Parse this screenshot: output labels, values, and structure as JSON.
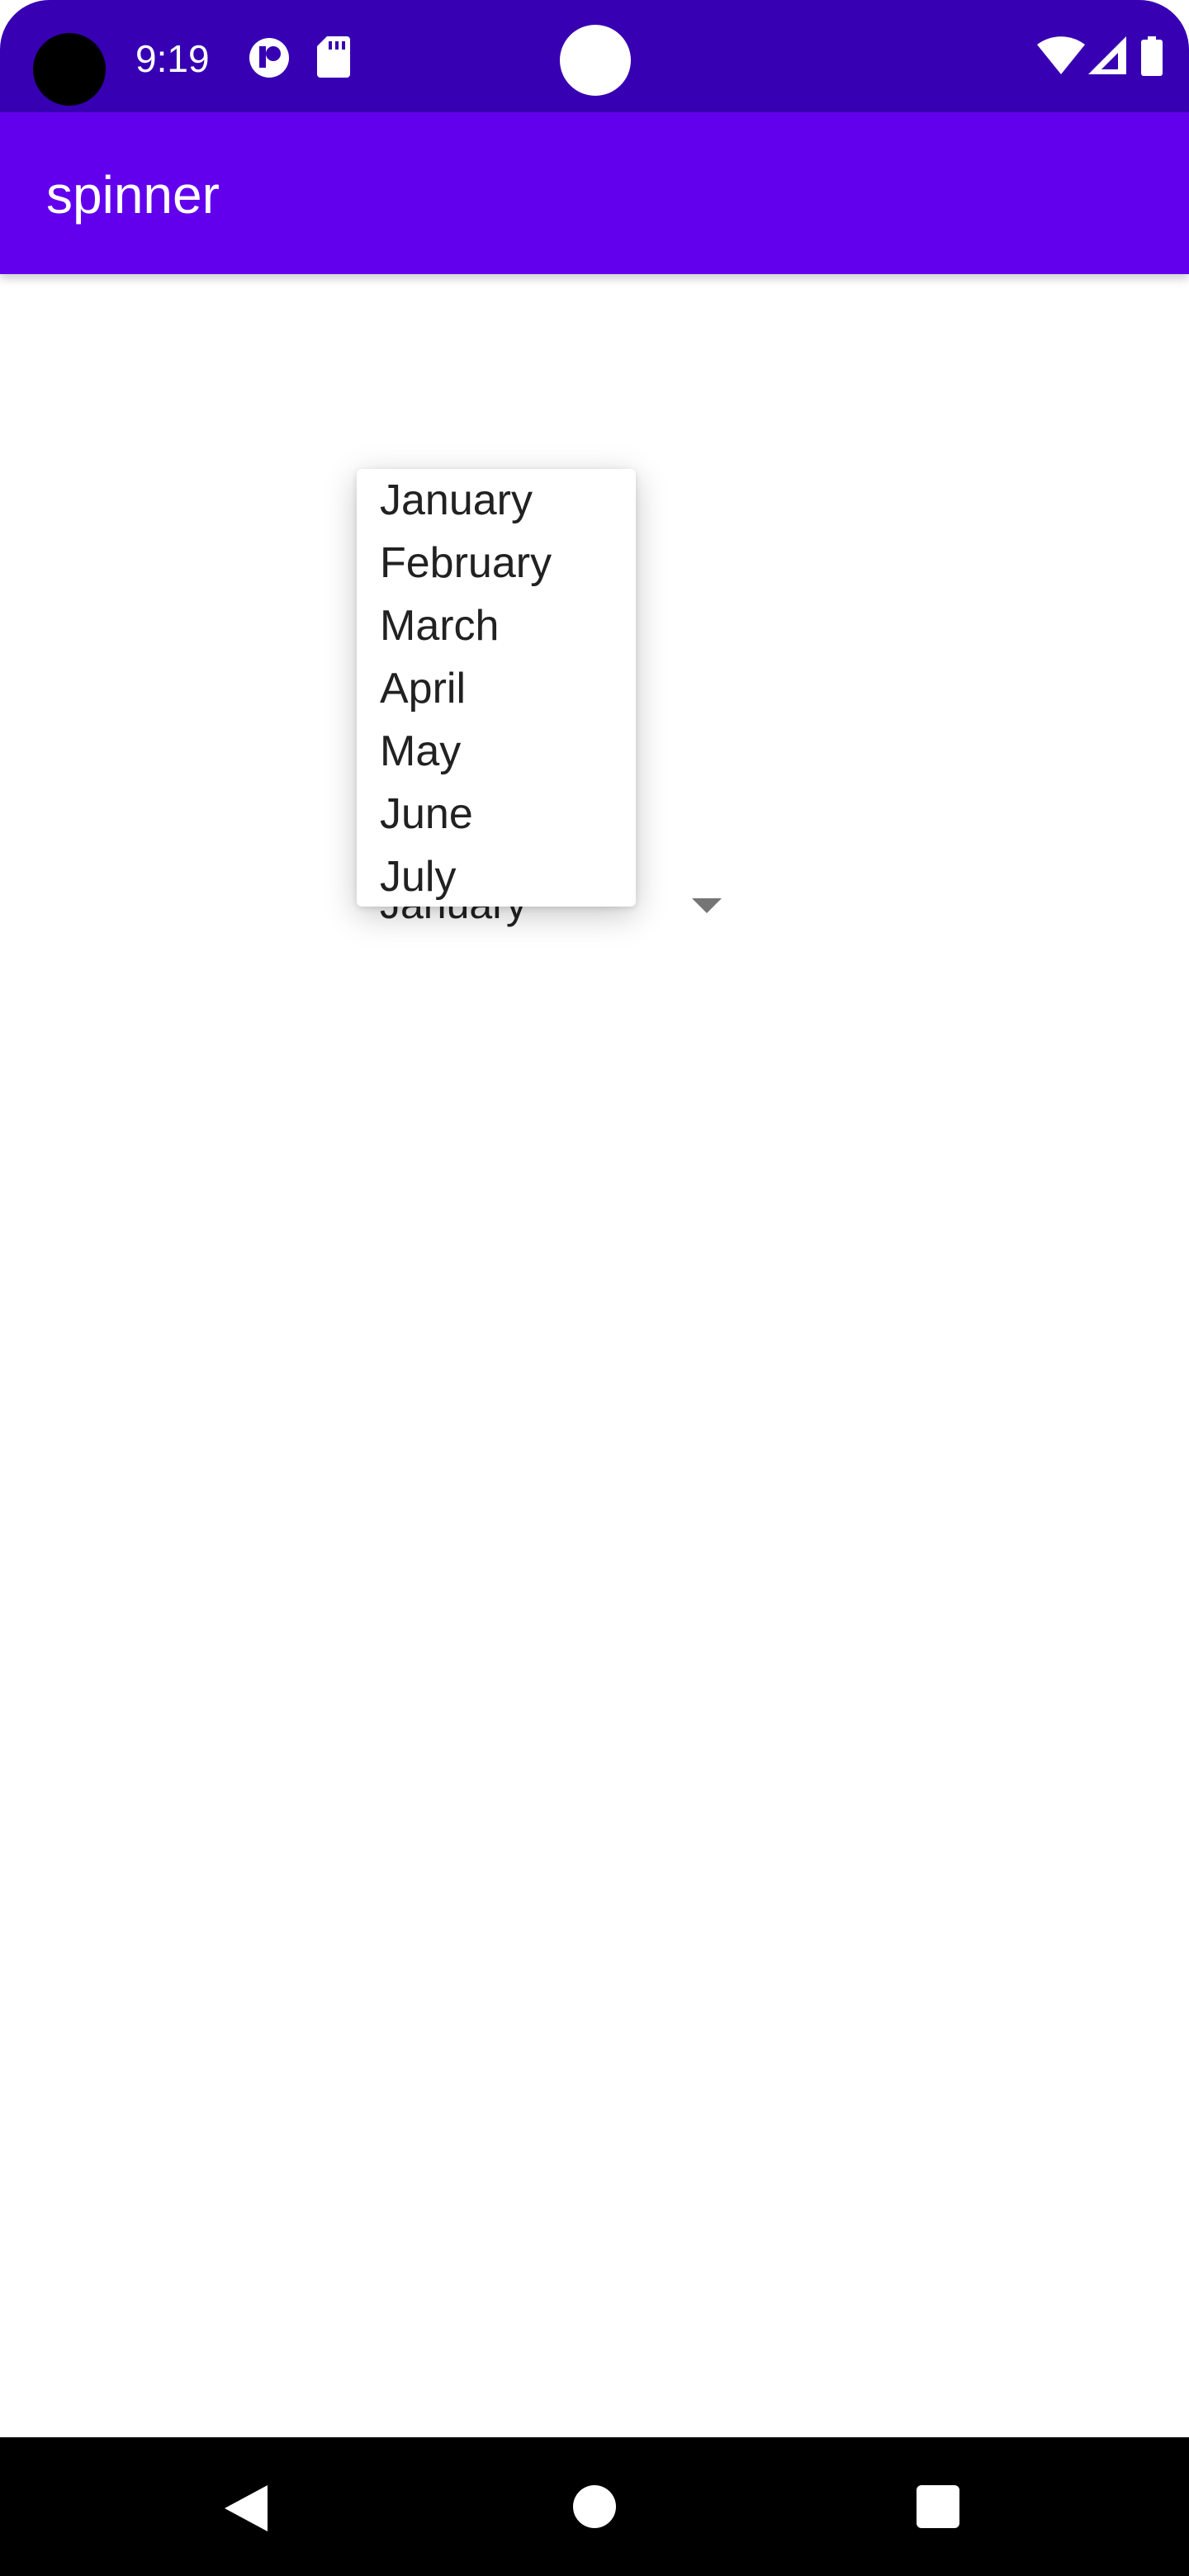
{
  "status_bar": {
    "time": "9:19",
    "icons": [
      "camera-cutout-icon",
      "notification-app-icon",
      "sd-card-icon",
      "center-dot-icon",
      "wifi-icon",
      "signal-icon",
      "battery-icon"
    ],
    "color": "#3700b3"
  },
  "app_bar": {
    "title": "spinner",
    "color": "#6200ee"
  },
  "spinner": {
    "selected_value": "January",
    "arrow_icon": "dropdown-arrow-icon"
  },
  "dropdown": {
    "items": [
      "January",
      "February",
      "March",
      "April",
      "May",
      "June",
      "July"
    ]
  },
  "nav_bar": {
    "icons": [
      "back-icon",
      "home-icon",
      "recents-icon"
    ]
  }
}
